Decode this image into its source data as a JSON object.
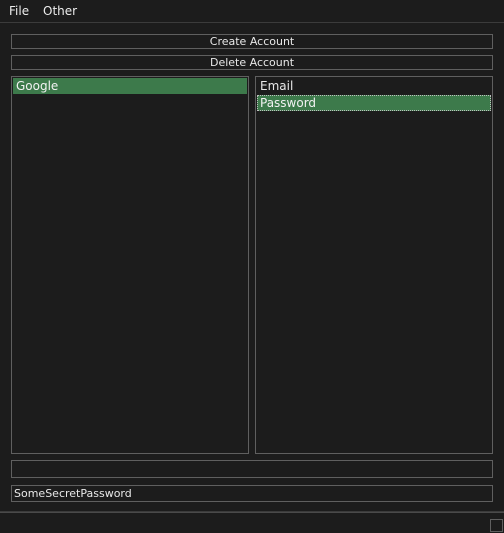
{
  "menu": {
    "file": "File",
    "other": "Other"
  },
  "buttons": {
    "create_account": "Create Account",
    "delete_account": "Delete Account"
  },
  "accounts_list": {
    "items": [
      "Google"
    ],
    "selected": "Google"
  },
  "fields_list": {
    "items": [
      "Email",
      "Password"
    ],
    "selected": "Password"
  },
  "inputs": {
    "top_value": "",
    "bottom_value": "SomeSecretPassword"
  },
  "colors": {
    "background": "#1c1c1c",
    "border": "#5f5f5f",
    "selection": "#3d7a4b",
    "text": "#e8e8e8"
  }
}
